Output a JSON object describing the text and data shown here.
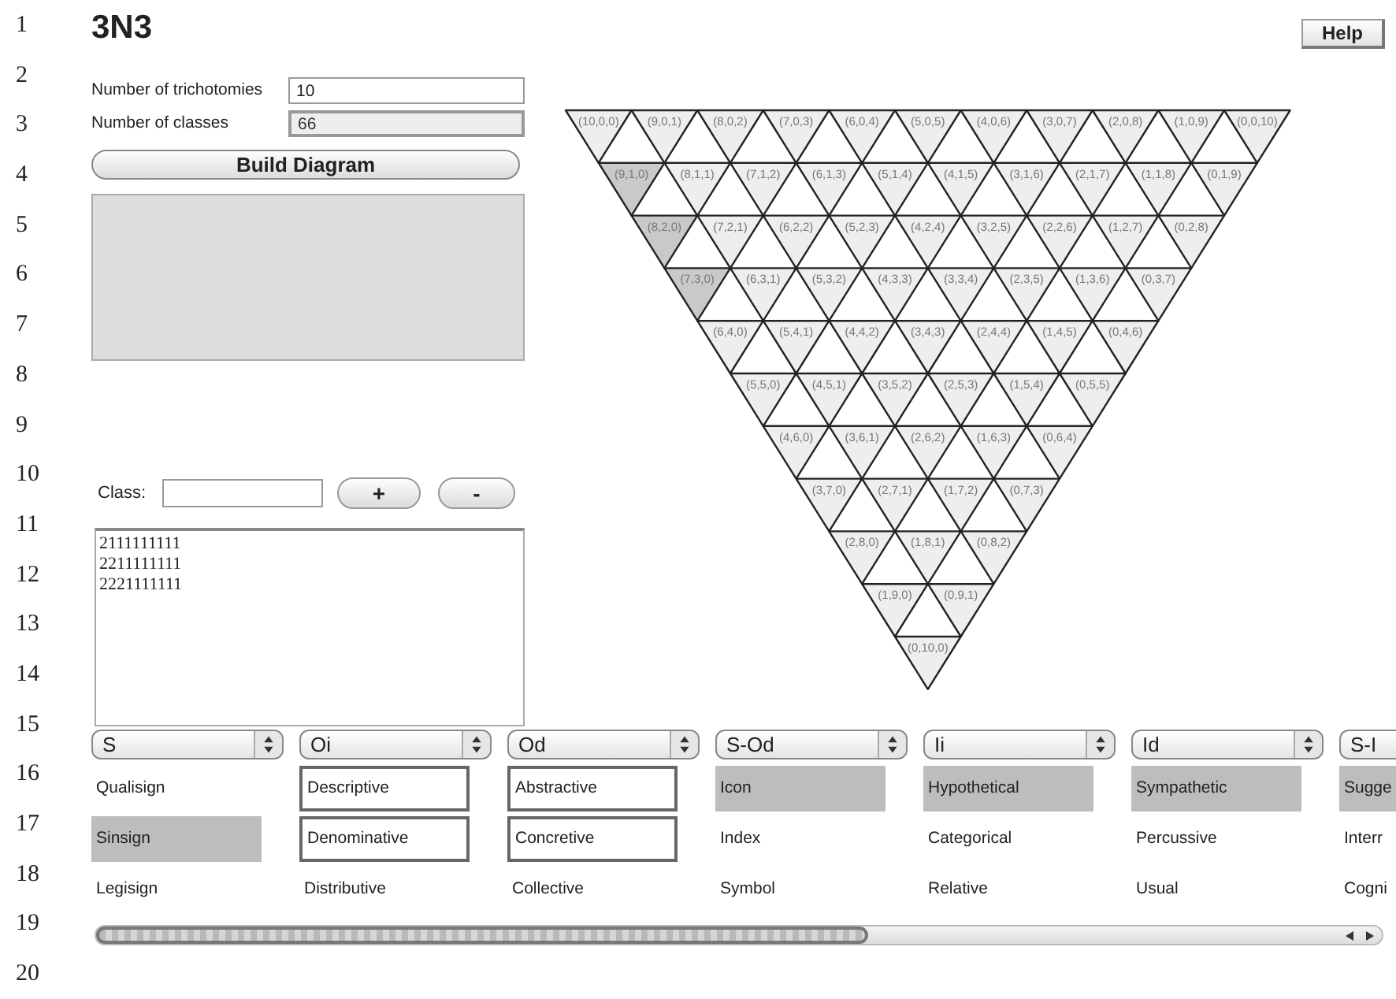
{
  "line_numbers": [
    "1",
    "2",
    "3",
    "4",
    "5",
    "6",
    "7",
    "8",
    "9",
    "10",
    "11",
    "12",
    "13",
    "14",
    "15",
    "16",
    "17",
    "18",
    "19",
    "20"
  ],
  "title": "3N3",
  "help_button": "Help",
  "fields": [
    {
      "label": "Number of trichotomies",
      "value": "10",
      "disabled": false
    },
    {
      "label": "Number of classes",
      "value": "66",
      "disabled": true
    }
  ],
  "build_button": "Build Diagram",
  "class_input": {
    "label": "Class:",
    "add": "+",
    "remove": "-"
  },
  "class_list": [
    "2111111111",
    "2211111111",
    "2221111111"
  ],
  "diagram": {
    "rows": [
      [
        {
          "label": "(10,0,0)",
          "shaded": false
        },
        {
          "label": "(9,0,1)",
          "shaded": false
        },
        {
          "label": "(8,0,2)",
          "shaded": false
        },
        {
          "label": "(7,0,3)",
          "shaded": false
        },
        {
          "label": "(6,0,4)",
          "shaded": false
        },
        {
          "label": "(5,0,5)",
          "shaded": false
        },
        {
          "label": "(4,0,6)",
          "shaded": false
        },
        {
          "label": "(3,0,7)",
          "shaded": false
        },
        {
          "label": "(2,0,8)",
          "shaded": false
        },
        {
          "label": "(1,0,9)",
          "shaded": false
        },
        {
          "label": "(0,0,10)",
          "shaded": false
        }
      ],
      [
        {
          "label": "(9,1,0)",
          "shaded": true
        },
        {
          "label": "(8,1,1)",
          "shaded": false
        },
        {
          "label": "(7,1,2)",
          "shaded": false
        },
        {
          "label": "(6,1,3)",
          "shaded": false
        },
        {
          "label": "(5,1,4)",
          "shaded": false
        },
        {
          "label": "(4,1,5)",
          "shaded": false
        },
        {
          "label": "(3,1,6)",
          "shaded": false
        },
        {
          "label": "(2,1,7)",
          "shaded": false
        },
        {
          "label": "(1,1,8)",
          "shaded": false
        },
        {
          "label": "(0,1,9)",
          "shaded": false
        }
      ],
      [
        {
          "label": "(8,2,0)",
          "shaded": true
        },
        {
          "label": "(7,2,1)",
          "shaded": false
        },
        {
          "label": "(6,2,2)",
          "shaded": false
        },
        {
          "label": "(5,2,3)",
          "shaded": false
        },
        {
          "label": "(4,2,4)",
          "shaded": false
        },
        {
          "label": "(3,2,5)",
          "shaded": false
        },
        {
          "label": "(2,2,6)",
          "shaded": false
        },
        {
          "label": "(1,2,7)",
          "shaded": false
        },
        {
          "label": "(0,2,8)",
          "shaded": false
        }
      ],
      [
        {
          "label": "(7,3,0)",
          "shaded": true
        },
        {
          "label": "(6,3,1)",
          "shaded": false
        },
        {
          "label": "(5,3,2)",
          "shaded": false
        },
        {
          "label": "(4,3,3)",
          "shaded": false
        },
        {
          "label": "(3,3,4)",
          "shaded": false
        },
        {
          "label": "(2,3,5)",
          "shaded": false
        },
        {
          "label": "(1,3,6)",
          "shaded": false
        },
        {
          "label": "(0,3,7)",
          "shaded": false
        }
      ],
      [
        {
          "label": "(6,4,0)",
          "shaded": false
        },
        {
          "label": "(5,4,1)",
          "shaded": false
        },
        {
          "label": "(4,4,2)",
          "shaded": false
        },
        {
          "label": "(3,4,3)",
          "shaded": false
        },
        {
          "label": "(2,4,4)",
          "shaded": false
        },
        {
          "label": "(1,4,5)",
          "shaded": false
        },
        {
          "label": "(0,4,6)",
          "shaded": false
        }
      ],
      [
        {
          "label": "(5,5,0)",
          "shaded": false
        },
        {
          "label": "(4,5,1)",
          "shaded": false
        },
        {
          "label": "(3,5,2)",
          "shaded": false
        },
        {
          "label": "(2,5,3)",
          "shaded": false
        },
        {
          "label": "(1,5,4)",
          "shaded": false
        },
        {
          "label": "(0,5,5)",
          "shaded": false
        }
      ],
      [
        {
          "label": "(4,6,0)",
          "shaded": false
        },
        {
          "label": "(3,6,1)",
          "shaded": false
        },
        {
          "label": "(2,6,2)",
          "shaded": false
        },
        {
          "label": "(1,6,3)",
          "shaded": false
        },
        {
          "label": "(0,6,4)",
          "shaded": false
        }
      ],
      [
        {
          "label": "(3,7,0)",
          "shaded": false
        },
        {
          "label": "(2,7,1)",
          "shaded": false
        },
        {
          "label": "(1,7,2)",
          "shaded": false
        },
        {
          "label": "(0,7,3)",
          "shaded": false
        }
      ],
      [
        {
          "label": "(2,8,0)",
          "shaded": false
        },
        {
          "label": "(1,8,1)",
          "shaded": false
        },
        {
          "label": "(0,8,2)",
          "shaded": false
        }
      ],
      [
        {
          "label": "(1,9,0)",
          "shaded": false
        },
        {
          "label": "(0,9,1)",
          "shaded": false
        }
      ],
      [
        {
          "label": "(0,10,0)",
          "shaded": false
        }
      ]
    ]
  },
  "trichotomies": [
    {
      "value": "S",
      "cut": false,
      "items": [
        {
          "label": "Qualisign",
          "selected": false,
          "outlined": false
        },
        {
          "label": "Sinsign",
          "selected": true,
          "outlined": false
        },
        {
          "label": "Legisign",
          "selected": false,
          "outlined": false
        }
      ]
    },
    {
      "value": "Oi",
      "cut": false,
      "items": [
        {
          "label": "Descriptive",
          "selected": false,
          "outlined": true
        },
        {
          "label": "Denominative",
          "selected": false,
          "outlined": true
        },
        {
          "label": "Distributive",
          "selected": false,
          "outlined": false
        }
      ]
    },
    {
      "value": "Od",
      "cut": false,
      "items": [
        {
          "label": "Abstractive",
          "selected": false,
          "outlined": true
        },
        {
          "label": "Concretive",
          "selected": false,
          "outlined": true
        },
        {
          "label": "Collective",
          "selected": false,
          "outlined": false
        }
      ]
    },
    {
      "value": "S-Od",
      "cut": false,
      "items": [
        {
          "label": "Icon",
          "selected": true,
          "outlined": false
        },
        {
          "label": "Index",
          "selected": false,
          "outlined": false
        },
        {
          "label": "Symbol",
          "selected": false,
          "outlined": false
        }
      ]
    },
    {
      "value": "Ii",
      "cut": false,
      "items": [
        {
          "label": "Hypothetical",
          "selected": true,
          "outlined": false
        },
        {
          "label": "Categorical",
          "selected": false,
          "outlined": false
        },
        {
          "label": "Relative",
          "selected": false,
          "outlined": false
        }
      ]
    },
    {
      "value": "Id",
      "cut": false,
      "items": [
        {
          "label": "Sympathetic",
          "selected": true,
          "outlined": false
        },
        {
          "label": "Percussive",
          "selected": false,
          "outlined": false
        },
        {
          "label": "Usual",
          "selected": false,
          "outlined": false
        }
      ]
    },
    {
      "value": "S-I",
      "cut": true,
      "items": [
        {
          "label": "Sugge",
          "selected": true,
          "outlined": false
        },
        {
          "label": "Interr",
          "selected": false,
          "outlined": false
        },
        {
          "label": "Cogni",
          "selected": false,
          "outlined": false
        }
      ]
    }
  ]
}
